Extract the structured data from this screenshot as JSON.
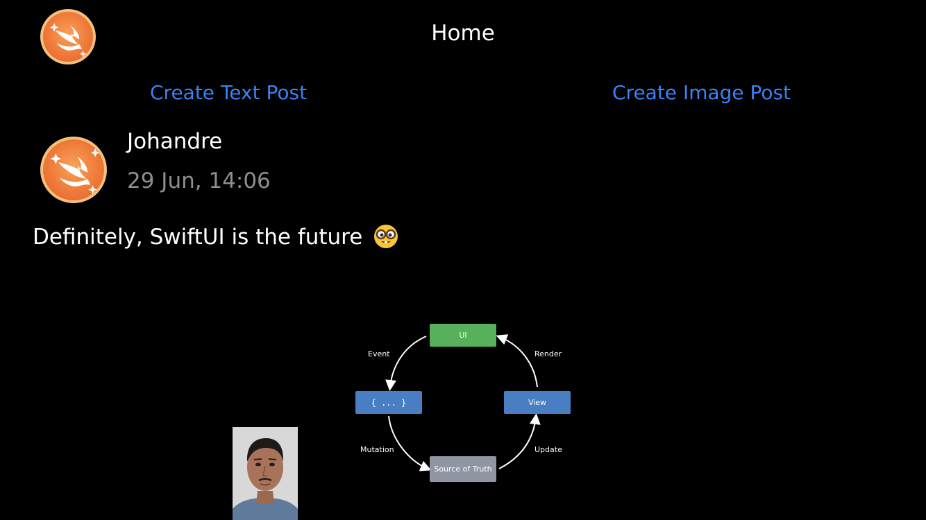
{
  "nav": {
    "title": "Home",
    "avatar_icon": "swift-logo-icon"
  },
  "actions": {
    "create_text_post": "Create Text Post",
    "create_image_post": "Create Image Post"
  },
  "post": {
    "author": "Johandre",
    "timestamp": "29 Jun, 14:06",
    "body": "Definitely, SwiftUI is the future",
    "body_emoji": "nerd-face-emoji",
    "avatar_icon": "swift-logo-icon"
  },
  "diagram": {
    "boxes": {
      "ui": "UI",
      "code": "{ ... }",
      "view": "View",
      "source": "Source of Truth"
    },
    "labels": {
      "event": "Event",
      "render": "Render",
      "mutation": "Mutation",
      "update": "Update"
    }
  },
  "colors": {
    "link": "#3a82f7",
    "secondary_text": "#8e8e93",
    "ui_box": "#57b15b",
    "blue_box": "#4a7ec3",
    "source_box": "#8f96a3"
  }
}
